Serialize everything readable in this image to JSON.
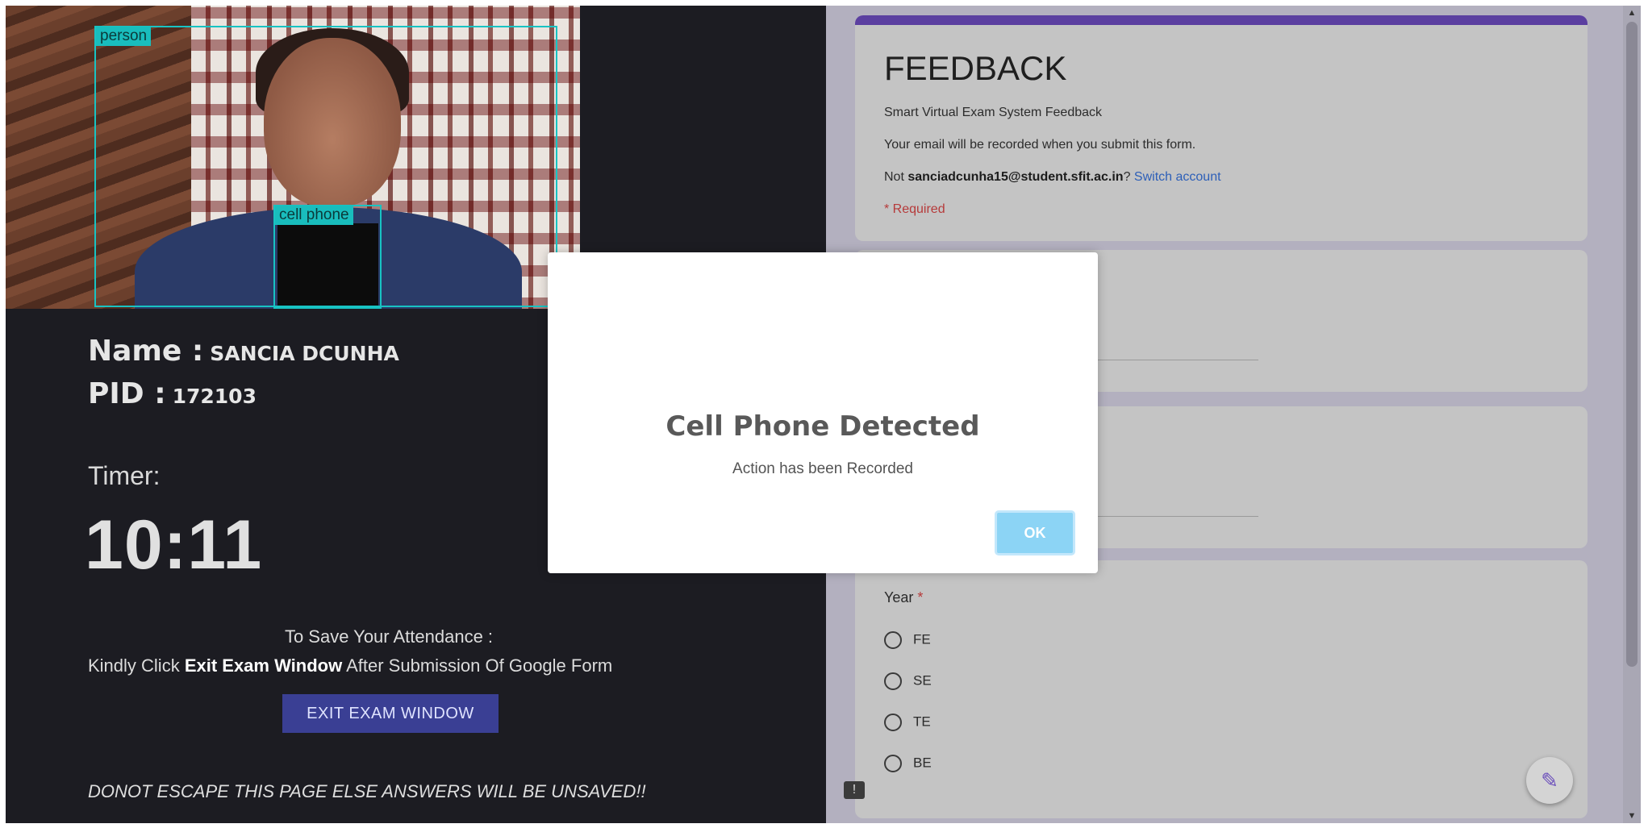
{
  "camera": {
    "labels": {
      "person": "person",
      "phone": "cell phone"
    }
  },
  "student": {
    "name_label": "Name :",
    "name_value": "SANCIA DCUNHA",
    "pid_label": "PID :",
    "pid_value": "172103"
  },
  "timer": {
    "label": "Timer:",
    "value": "10:11"
  },
  "attendance": {
    "line1": "To Save Your Attendance :",
    "line2_prefix": "Kindly Click ",
    "line2_bold": "Exit Exam Window",
    "line2_suffix": " After Submission Of Google Form",
    "exit_button": "EXIT EXAM WINDOW",
    "warning": "DONOT ESCAPE THIS PAGE ELSE ANSWERS WILL BE UNSAVED!!"
  },
  "form": {
    "title": "FEEDBACK",
    "description": "Smart Virtual Exam System Feedback",
    "email_notice": "Your email will be recorded when you submit this form.",
    "account_prefix": "Not ",
    "account_email": "sanciadcunha15@student.sfit.ac.in",
    "account_suffix": "? ",
    "switch_account": "Switch account",
    "required_note": "* Required",
    "year_question": "Year",
    "year_required_mark": "*",
    "year_options": [
      "FE",
      "SE",
      "TE",
      "BE"
    ]
  },
  "modal": {
    "title": "Cell Phone Detected",
    "text": "Action has been Recorded",
    "ok_button": "OK"
  },
  "colors": {
    "left_bg": "#1c1c22",
    "detection_box": "#18c3c3",
    "exit_button_bg": "#3a3f94",
    "form_accent": "#5b3fa0",
    "ok_button_bg": "#8cd4f5"
  }
}
